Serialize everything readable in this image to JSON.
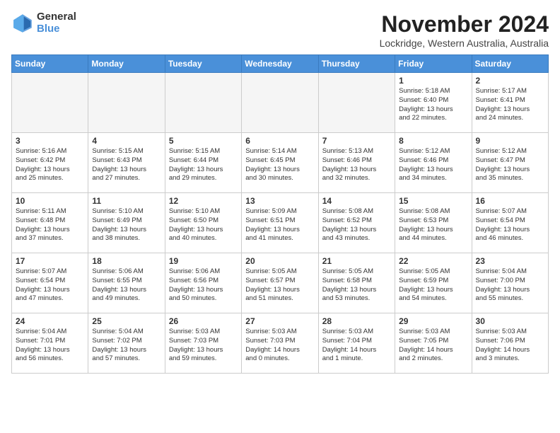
{
  "logo": {
    "general": "General",
    "blue": "Blue"
  },
  "title": "November 2024",
  "location": "Lockridge, Western Australia, Australia",
  "weekdays": [
    "Sunday",
    "Monday",
    "Tuesday",
    "Wednesday",
    "Thursday",
    "Friday",
    "Saturday"
  ],
  "weeks": [
    [
      {
        "day": "",
        "info": ""
      },
      {
        "day": "",
        "info": ""
      },
      {
        "day": "",
        "info": ""
      },
      {
        "day": "",
        "info": ""
      },
      {
        "day": "",
        "info": ""
      },
      {
        "day": "1",
        "info": "Sunrise: 5:18 AM\nSunset: 6:40 PM\nDaylight: 13 hours\nand 22 minutes."
      },
      {
        "day": "2",
        "info": "Sunrise: 5:17 AM\nSunset: 6:41 PM\nDaylight: 13 hours\nand 24 minutes."
      }
    ],
    [
      {
        "day": "3",
        "info": "Sunrise: 5:16 AM\nSunset: 6:42 PM\nDaylight: 13 hours\nand 25 minutes."
      },
      {
        "day": "4",
        "info": "Sunrise: 5:15 AM\nSunset: 6:43 PM\nDaylight: 13 hours\nand 27 minutes."
      },
      {
        "day": "5",
        "info": "Sunrise: 5:15 AM\nSunset: 6:44 PM\nDaylight: 13 hours\nand 29 minutes."
      },
      {
        "day": "6",
        "info": "Sunrise: 5:14 AM\nSunset: 6:45 PM\nDaylight: 13 hours\nand 30 minutes."
      },
      {
        "day": "7",
        "info": "Sunrise: 5:13 AM\nSunset: 6:46 PM\nDaylight: 13 hours\nand 32 minutes."
      },
      {
        "day": "8",
        "info": "Sunrise: 5:12 AM\nSunset: 6:46 PM\nDaylight: 13 hours\nand 34 minutes."
      },
      {
        "day": "9",
        "info": "Sunrise: 5:12 AM\nSunset: 6:47 PM\nDaylight: 13 hours\nand 35 minutes."
      }
    ],
    [
      {
        "day": "10",
        "info": "Sunrise: 5:11 AM\nSunset: 6:48 PM\nDaylight: 13 hours\nand 37 minutes."
      },
      {
        "day": "11",
        "info": "Sunrise: 5:10 AM\nSunset: 6:49 PM\nDaylight: 13 hours\nand 38 minutes."
      },
      {
        "day": "12",
        "info": "Sunrise: 5:10 AM\nSunset: 6:50 PM\nDaylight: 13 hours\nand 40 minutes."
      },
      {
        "day": "13",
        "info": "Sunrise: 5:09 AM\nSunset: 6:51 PM\nDaylight: 13 hours\nand 41 minutes."
      },
      {
        "day": "14",
        "info": "Sunrise: 5:08 AM\nSunset: 6:52 PM\nDaylight: 13 hours\nand 43 minutes."
      },
      {
        "day": "15",
        "info": "Sunrise: 5:08 AM\nSunset: 6:53 PM\nDaylight: 13 hours\nand 44 minutes."
      },
      {
        "day": "16",
        "info": "Sunrise: 5:07 AM\nSunset: 6:54 PM\nDaylight: 13 hours\nand 46 minutes."
      }
    ],
    [
      {
        "day": "17",
        "info": "Sunrise: 5:07 AM\nSunset: 6:54 PM\nDaylight: 13 hours\nand 47 minutes."
      },
      {
        "day": "18",
        "info": "Sunrise: 5:06 AM\nSunset: 6:55 PM\nDaylight: 13 hours\nand 49 minutes."
      },
      {
        "day": "19",
        "info": "Sunrise: 5:06 AM\nSunset: 6:56 PM\nDaylight: 13 hours\nand 50 minutes."
      },
      {
        "day": "20",
        "info": "Sunrise: 5:05 AM\nSunset: 6:57 PM\nDaylight: 13 hours\nand 51 minutes."
      },
      {
        "day": "21",
        "info": "Sunrise: 5:05 AM\nSunset: 6:58 PM\nDaylight: 13 hours\nand 53 minutes."
      },
      {
        "day": "22",
        "info": "Sunrise: 5:05 AM\nSunset: 6:59 PM\nDaylight: 13 hours\nand 54 minutes."
      },
      {
        "day": "23",
        "info": "Sunrise: 5:04 AM\nSunset: 7:00 PM\nDaylight: 13 hours\nand 55 minutes."
      }
    ],
    [
      {
        "day": "24",
        "info": "Sunrise: 5:04 AM\nSunset: 7:01 PM\nDaylight: 13 hours\nand 56 minutes."
      },
      {
        "day": "25",
        "info": "Sunrise: 5:04 AM\nSunset: 7:02 PM\nDaylight: 13 hours\nand 57 minutes."
      },
      {
        "day": "26",
        "info": "Sunrise: 5:03 AM\nSunset: 7:03 PM\nDaylight: 13 hours\nand 59 minutes."
      },
      {
        "day": "27",
        "info": "Sunrise: 5:03 AM\nSunset: 7:03 PM\nDaylight: 14 hours\nand 0 minutes."
      },
      {
        "day": "28",
        "info": "Sunrise: 5:03 AM\nSunset: 7:04 PM\nDaylight: 14 hours\nand 1 minute."
      },
      {
        "day": "29",
        "info": "Sunrise: 5:03 AM\nSunset: 7:05 PM\nDaylight: 14 hours\nand 2 minutes."
      },
      {
        "day": "30",
        "info": "Sunrise: 5:03 AM\nSunset: 7:06 PM\nDaylight: 14 hours\nand 3 minutes."
      }
    ]
  ]
}
